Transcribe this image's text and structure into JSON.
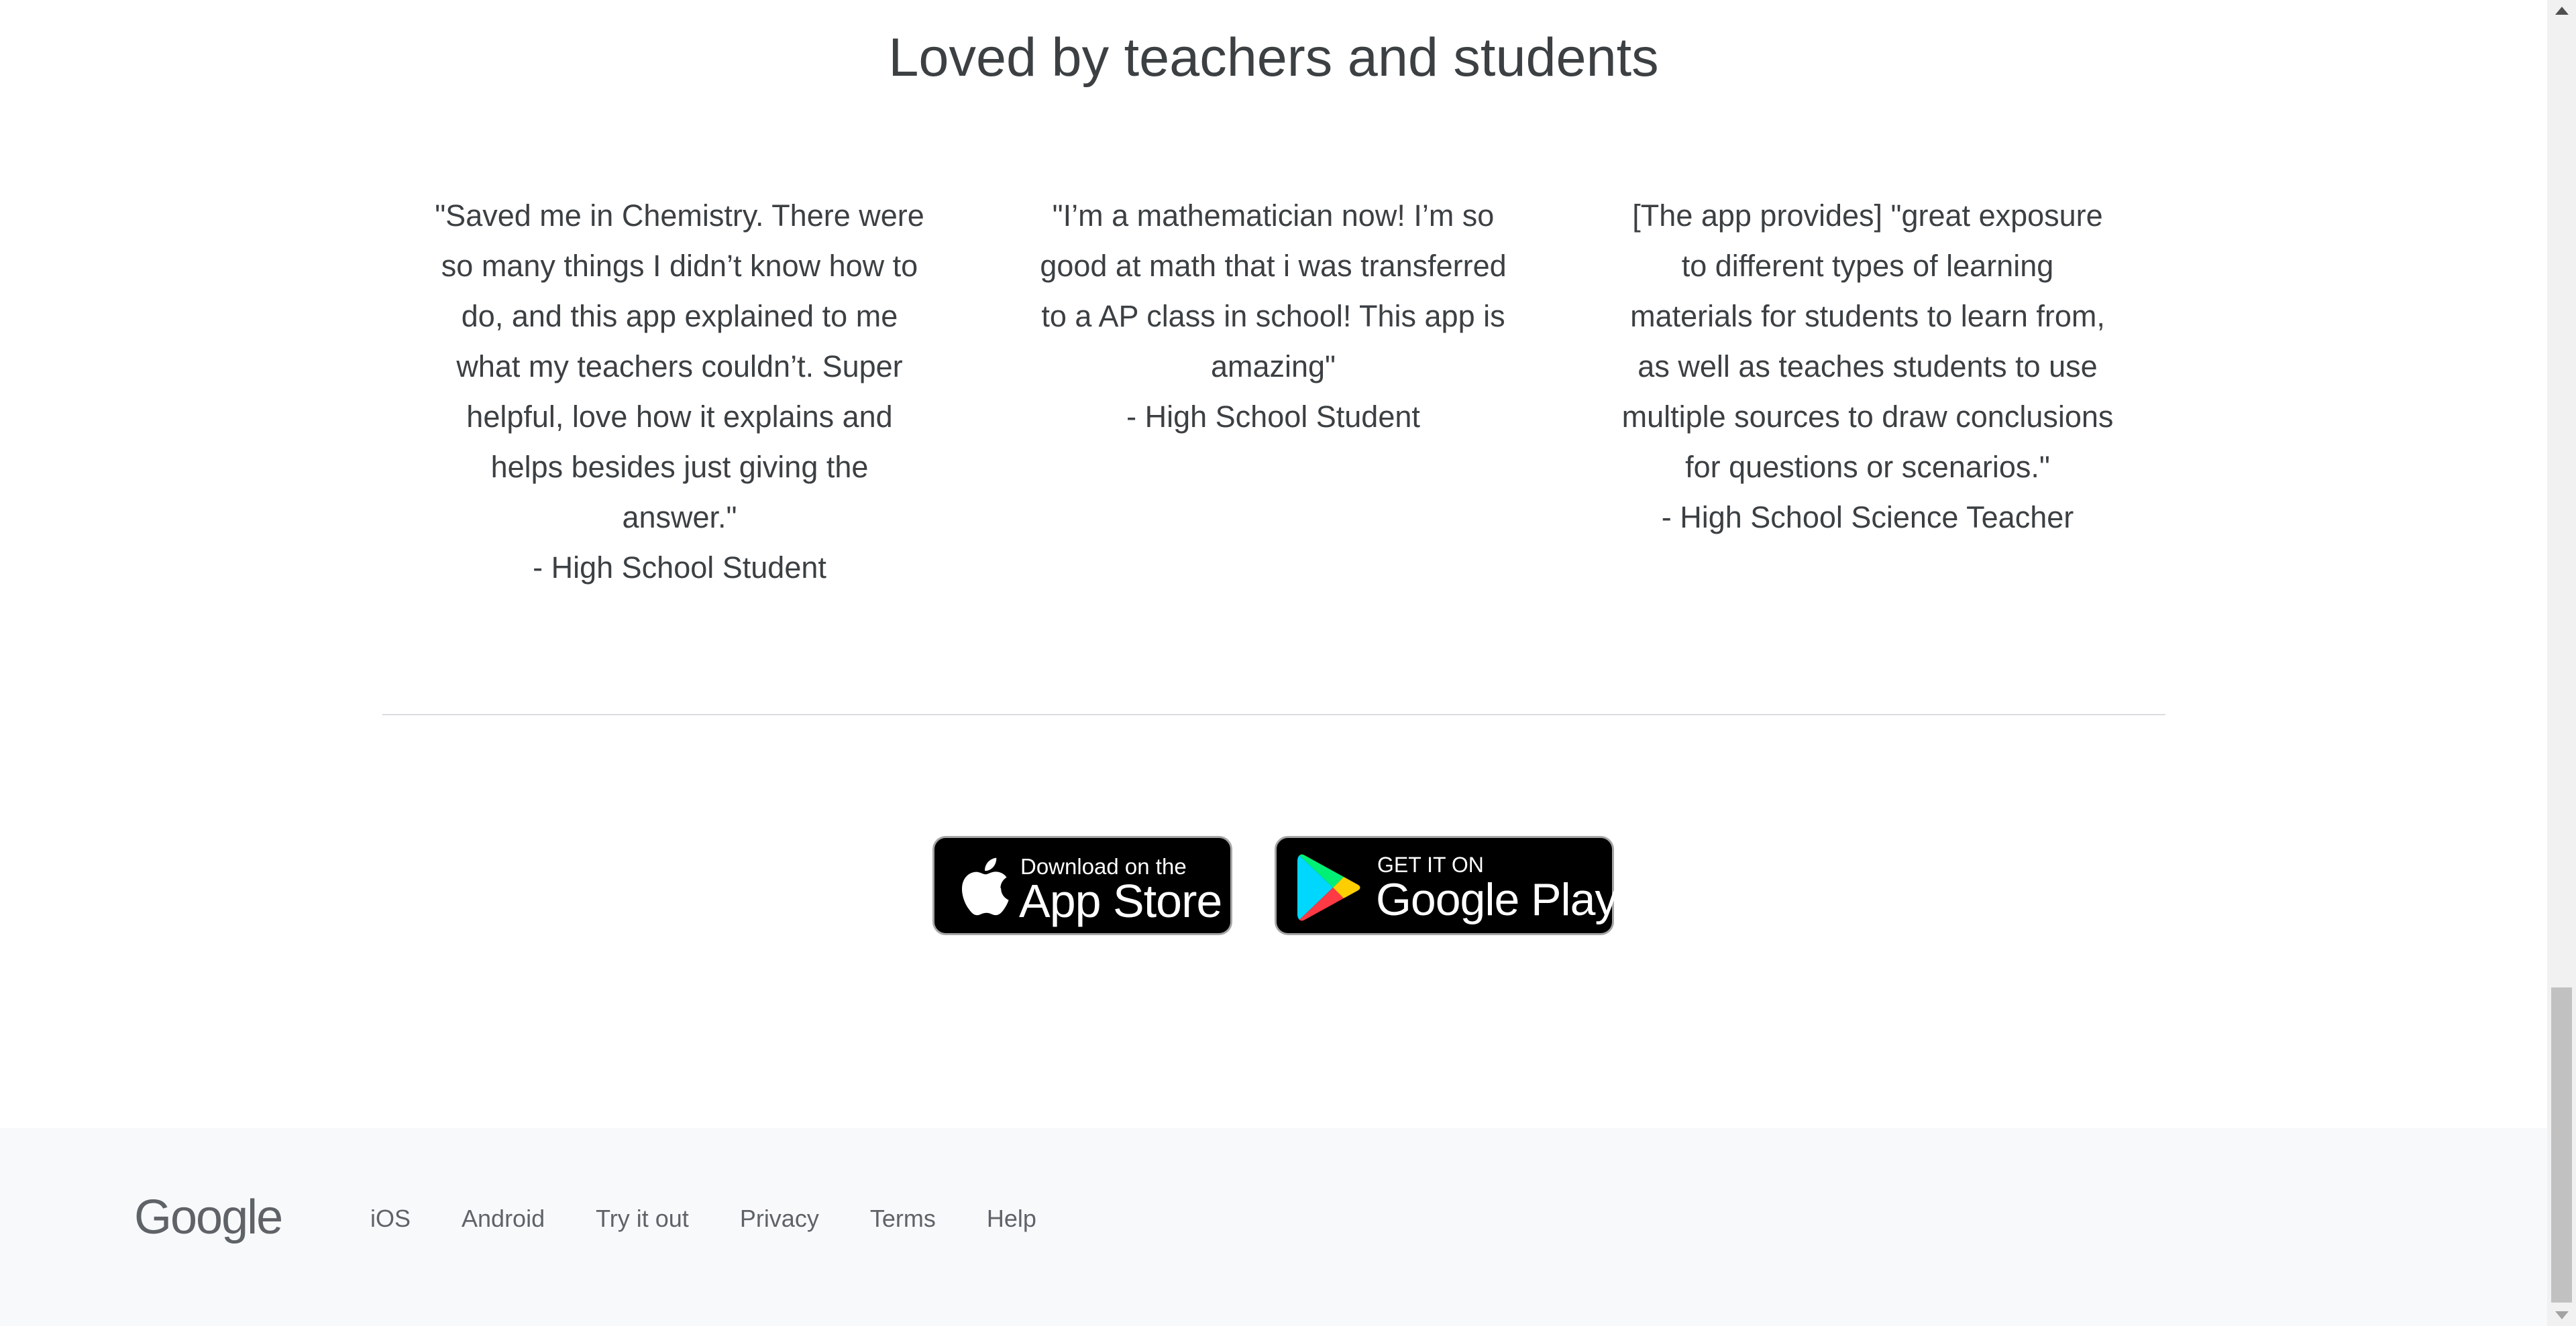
{
  "section": {
    "title": "Loved by teachers and students"
  },
  "testimonials": [
    {
      "quote": "\"Saved me in Chemistry. There were so many things I didn’t know how to do, and this app explained to me what my teachers couldn’t. Super helpful, love how it explains and helps besides just giving the answer.\"",
      "author": "- High School Student"
    },
    {
      "quote": "\"I’m a mathematician now! I’m so good at math that i was transferred to a AP class in school! This app is amazing\"",
      "author": "- High School Student"
    },
    {
      "quote": "[The app provides] \"great exposure to different types of learning materials for students to learn from, as well as teaches students to use multiple sources to draw conclusions for questions or scenarios.\"",
      "author": "- High School Science Teacher"
    }
  ],
  "badges": {
    "appstore": {
      "small": "Download on the",
      "big": "App Store",
      "icon": "apple-icon"
    },
    "googleplay": {
      "small": "GET IT ON",
      "big": "Google Play",
      "icon": "google-play-icon"
    }
  },
  "footer": {
    "logo": "Google",
    "links": [
      "iOS",
      "Android",
      "Try it out",
      "Privacy",
      "Terms",
      "Help"
    ]
  },
  "colors": {
    "footer_bg": "#f8f9fa",
    "text": "#3c4043",
    "link": "#5f6368",
    "badge_bg": "#000000"
  }
}
